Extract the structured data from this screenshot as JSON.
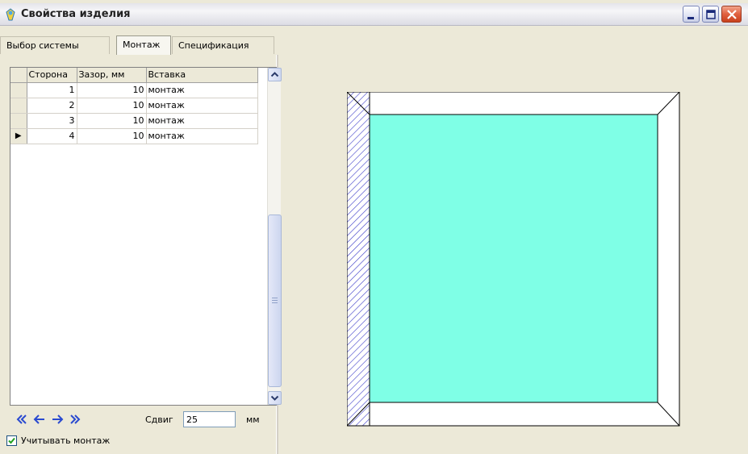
{
  "window": {
    "title": "Свойства изделия"
  },
  "tabs": [
    {
      "label": "Выбор системы"
    },
    {
      "label": "Монтаж"
    },
    {
      "label": "Спецификация"
    }
  ],
  "grid": {
    "columns": [
      "Сторона",
      "Зазор, мм",
      "Вставка"
    ],
    "rows": [
      {
        "side": "1",
        "gap": "10",
        "insert": "монтаж"
      },
      {
        "side": "2",
        "gap": "10",
        "insert": "монтаж"
      },
      {
        "side": "3",
        "gap": "10",
        "insert": "монтаж"
      },
      {
        "side": "4",
        "gap": "10",
        "insert": "монтаж"
      }
    ],
    "current_row_indicator": "▶"
  },
  "navigation": {
    "first": "first-record-icon",
    "prev": "previous-record-icon",
    "next": "next-record-icon",
    "last": "last-record-icon"
  },
  "shift": {
    "label": "Сдвиг",
    "value": "25",
    "unit": "мм"
  },
  "account_mounting": {
    "label": "Учитывать монтаж",
    "checked": true
  },
  "colors": {
    "glass": "#7fffe6",
    "hatch": "#3a3ac8",
    "title_gradient": "#e4e4ea"
  }
}
